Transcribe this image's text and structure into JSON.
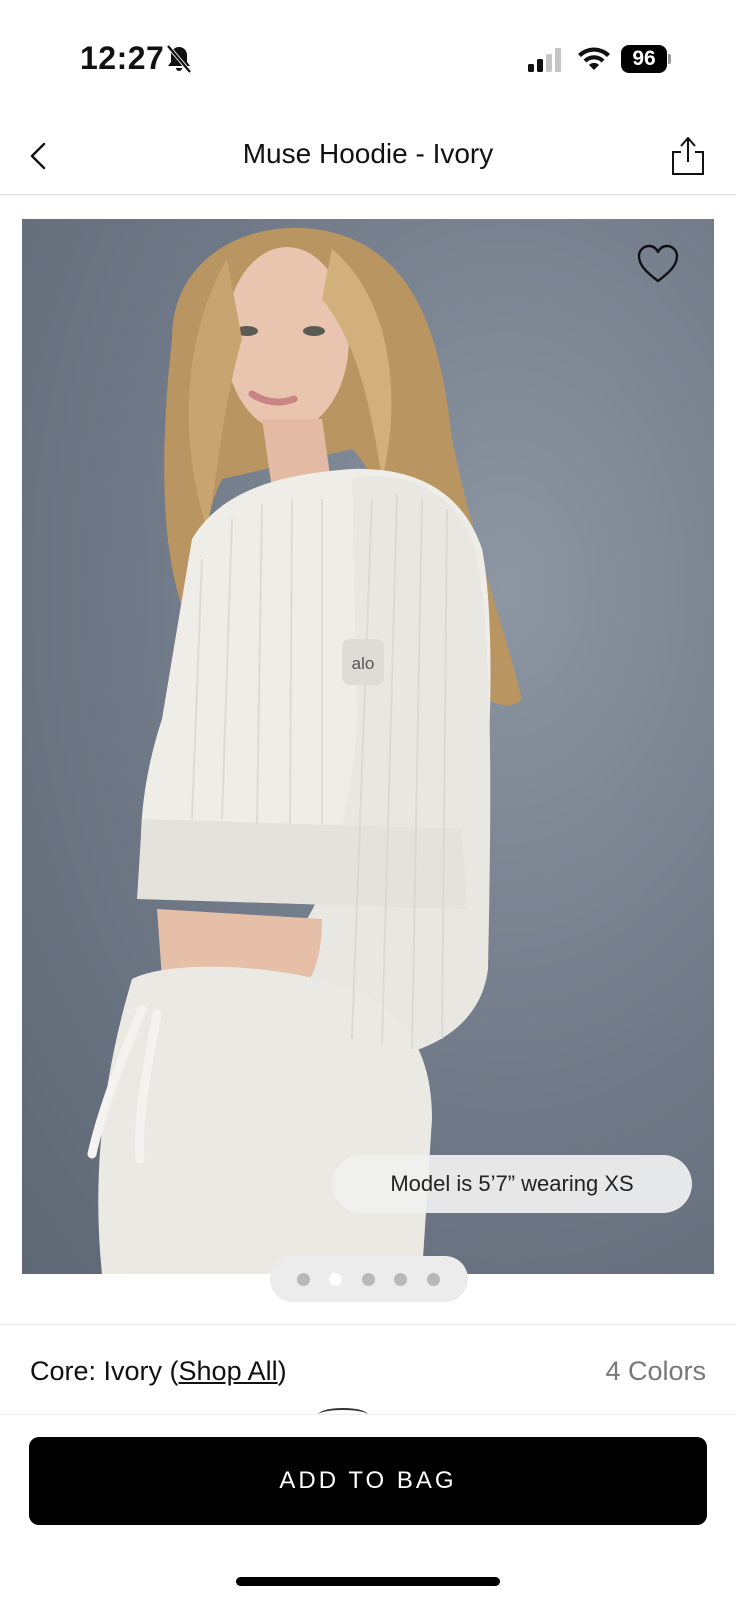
{
  "status_bar": {
    "time": "12:27",
    "battery": "96"
  },
  "header": {
    "title": "Muse Hoodie - Ivory"
  },
  "product_image": {
    "logo_patch": "alo",
    "model_info": "Model is 5’7” wearing XS",
    "pager": {
      "count": 5,
      "active_index": 1
    }
  },
  "color_selector": {
    "prefix": "Core: Ivory (",
    "shop_all": "Shop All",
    "suffix": ")",
    "colors_count": "4 Colors"
  },
  "actions": {
    "add_to_bag": "ADD TO BAG"
  },
  "colors": {
    "background": "#ffffff",
    "button": "#000000",
    "photo_backdrop": "#6f7886",
    "garment": "#efede8"
  },
  "icons": [
    "bell-slash-icon",
    "signal-icon",
    "wifi-icon",
    "battery-icon",
    "back-chevron-icon",
    "share-icon",
    "heart-icon"
  ]
}
